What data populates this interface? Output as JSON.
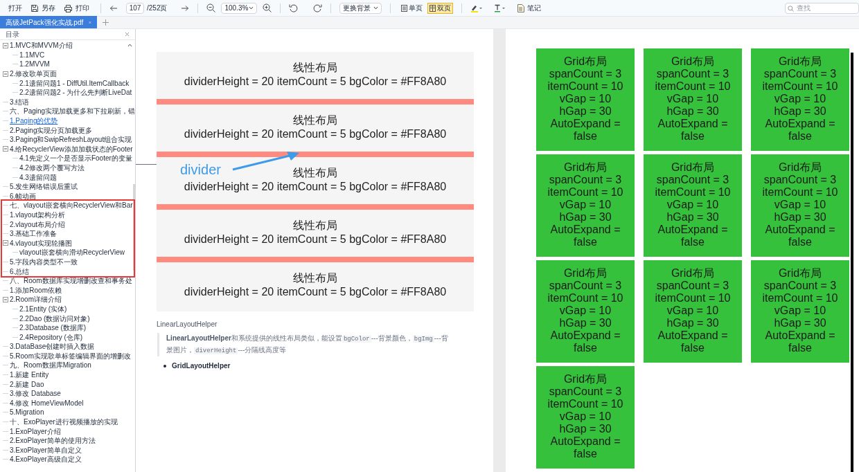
{
  "toolbar": {
    "open": "打开",
    "save_as": "另存",
    "print": "打印",
    "page_input": "107",
    "page_total": "/252页",
    "zoom": "100.3%",
    "background_menu": "更换背景",
    "view_modes": [
      {
        "label": "单页",
        "selected": false
      },
      {
        "label": "双页",
        "selected": true
      }
    ],
    "note": "笔记",
    "search": {
      "placeholder": "查找"
    }
  },
  "tabs": [
    {
      "label": "高级JetPack强化实战.pdf",
      "selected": true
    }
  ],
  "sidebar": {
    "title": "目录",
    "items": [
      {
        "label": "1.MVC和MVVM介绍",
        "selected": false,
        "expanded": true,
        "children": [
          {
            "label": "1.1MVC",
            "selected": false
          },
          {
            "label": "1.2MVVM",
            "selected": false
          }
        ]
      },
      {
        "label": "2.修改歌单页面",
        "selected": false,
        "expanded": true,
        "children": [
          {
            "label": "2.1遗留问题1 - DiffUtil.ItemCallback",
            "selected": false
          },
          {
            "label": "2.2遗留问题2 - 为什么先判断LiveDat",
            "selected": false
          }
        ]
      },
      {
        "label": "3.结语",
        "selected": false
      },
      {
        "label": "六、Paging实现加载更多和下拉刷新，错",
        "selected": false
      },
      {
        "label": "1.Paging的优势",
        "selected": true
      },
      {
        "label": "2.Paging实现分页加载更多",
        "selected": false
      },
      {
        "label": "3.Paging和SwipRefreshLayout组合实现",
        "selected": false
      },
      {
        "label": "4.给RecyclerView添加加载状态的Footer",
        "selected": false,
        "expanded": true,
        "children": [
          {
            "label": "4.1先定义一个是否显示Footer的变量",
            "selected": false
          },
          {
            "label": "4.2修改两个覆写方法",
            "selected": false
          },
          {
            "label": "4.3遗留问题",
            "selected": false
          }
        ]
      },
      {
        "label": "5.发生网络错误后重试",
        "selected": false
      },
      {
        "label": "6.帧动画",
        "selected": false
      },
      {
        "label": "七、vlayout嵌套横向RecyclerView和Bar",
        "selected": false
      },
      {
        "label": "1.vlayout架构分析",
        "selected": false
      },
      {
        "label": "2.vlayout布局介绍",
        "selected": false
      },
      {
        "label": "3.基础工作准备",
        "selected": false
      },
      {
        "label": "4.vlayout实现轮播图",
        "selected": false,
        "expanded": true,
        "children": [
          {
            "label": "vlayout嵌套横向滑动RecyclerView",
            "selected": false
          }
        ]
      },
      {
        "label": "5.字段内容类型不一致",
        "selected": false
      },
      {
        "label": "6.总结",
        "selected": false
      },
      {
        "label": "八、Room数据库实现增删改查和事务处",
        "selected": false
      },
      {
        "label": "1.添加Room依赖",
        "selected": false
      },
      {
        "label": "2.Room详细介绍",
        "selected": false,
        "expanded": true,
        "children": [
          {
            "label": "2.1Entity (实体)",
            "selected": false
          },
          {
            "label": "2.2Dao (数据访问对象)",
            "selected": false
          },
          {
            "label": "2.3Database (数据库)",
            "selected": false
          },
          {
            "label": "2.4Repository (仓库)",
            "selected": false
          }
        ]
      },
      {
        "label": "3.DataBase创建时插入数据",
        "selected": false
      },
      {
        "label": "5.Room实现歌单标签编辑界面的增删改",
        "selected": false
      },
      {
        "label": "九、Room数据库Migration",
        "selected": false
      },
      {
        "label": "1.新建 Entity",
        "selected": false
      },
      {
        "label": "2.新建 Dao",
        "selected": false
      },
      {
        "label": "3.修改 Database",
        "selected": false
      },
      {
        "label": "4.修改 HomeViewModel",
        "selected": false
      },
      {
        "label": "5.Migration",
        "selected": false
      },
      {
        "label": "十、ExoPlayer进行视频播放的实现",
        "selected": false
      },
      {
        "label": "1.ExoPlayer介绍",
        "selected": false
      },
      {
        "label": "2.ExoPlayer简单的使用方法",
        "selected": false
      },
      {
        "label": "3.ExoPlayer简单自定义",
        "selected": false
      },
      {
        "label": "4.ExoPlayer高级自定义",
        "selected": false
      }
    ]
  },
  "left_page": {
    "figure": {
      "items": [
        {
          "title": "线性布局",
          "text": "dividerHeight = 20 itemCount = 5 bgColor = #FF8A80",
          "divider": true
        },
        {
          "title": "线性布局",
          "text": "dividerHeight = 20 itemCount = 5 bgColor = #FF8A80",
          "divider": true
        },
        {
          "title": "线性布局",
          "text": "dividerHeight = 20 itemCount = 5 bgColor = #FF8A80",
          "divider": true
        },
        {
          "title": "线性布局",
          "text": "dividerHeight = 20 itemCount = 5 bgColor = #FF8A80",
          "divider": true
        },
        {
          "title": "线性布局",
          "text": "dividerHeight = 20 itemCount = 5 bgColor = #FF8A80",
          "divider": false
        }
      ],
      "annotation": "divider"
    },
    "caption": "LinearLayoutHelper",
    "quote": [
      {
        "kind": "bold",
        "text": "LinearLayoutHelper"
      },
      {
        "kind": "plain",
        "text": "和系统提供的线性布局类似，能设置"
      },
      {
        "kind": "code",
        "text": "bgColor"
      },
      {
        "kind": "plain",
        "text": "---背景颜色，"
      },
      {
        "kind": "code",
        "text": "bgImg"
      },
      {
        "kind": "plain",
        "text": "---背景图片，"
      },
      {
        "kind": "code",
        "text": "diverHeight"
      },
      {
        "kind": "plain",
        "text": "---分隔线高度等"
      }
    ],
    "bullets": [
      "GridLayoutHelper"
    ]
  },
  "right_page": {
    "grid_cells": [
      {
        "lines": [
          "Grid布局",
          "spanCount = 3",
          "itemCount = 10",
          "vGap = 10",
          "hGap = 30",
          "AutoExpand =",
          "false"
        ]
      },
      {
        "lines": [
          "Grid布局",
          "spanCount = 3",
          "itemCount = 10",
          "vGap = 10",
          "hGap = 30",
          "AutoExpand =",
          "false"
        ]
      },
      {
        "lines": [
          "Grid布局",
          "spanCount = 3",
          "itemCount = 10",
          "vGap = 10",
          "hGap = 30",
          "AutoExpand =",
          "false"
        ]
      },
      {
        "lines": [
          "Grid布局",
          "spanCount = 3",
          "itemCount = 10",
          "vGap = 10",
          "hGap = 30",
          "AutoExpand =",
          "false"
        ]
      },
      {
        "lines": [
          "Grid布局",
          "spanCount = 3",
          "itemCount = 10",
          "vGap = 10",
          "hGap = 30",
          "AutoExpand =",
          "false"
        ]
      },
      {
        "lines": [
          "Grid布局",
          "spanCount = 3",
          "itemCount = 10",
          "vGap = 10",
          "hGap = 30",
          "AutoExpand =",
          "false"
        ]
      },
      {
        "lines": [
          "Grid布局",
          "spanCount = 3",
          "itemCount = 10",
          "vGap = 10",
          "hGap = 30",
          "AutoExpand =",
          "false"
        ]
      },
      {
        "lines": [
          "Grid布局",
          "spanCount = 3",
          "itemCount = 10",
          "vGap = 10",
          "hGap = 30",
          "AutoExpand =",
          "false"
        ]
      },
      {
        "lines": [
          "Grid布局",
          "spanCount = 3",
          "itemCount = 10",
          "vGap = 10",
          "hGap = 30",
          "AutoExpand =",
          "false"
        ]
      },
      {
        "lines": [
          "Grid布局",
          "spanCount = 3",
          "itemCount = 10",
          "vGap = 10",
          "hGap = 30",
          "AutoExpand =",
          "false"
        ]
      }
    ]
  }
}
